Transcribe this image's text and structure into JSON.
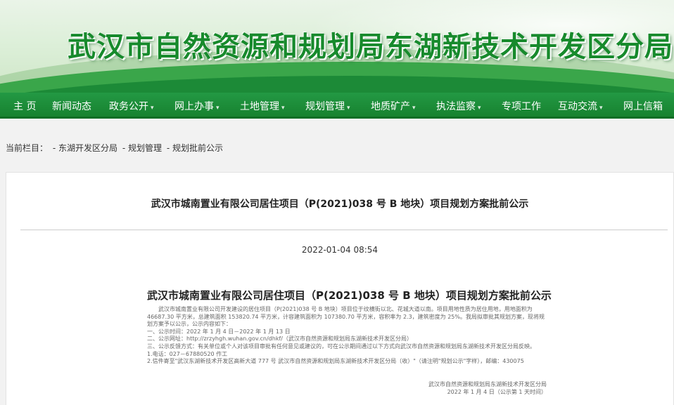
{
  "site_title": "武汉市自然资源和规划局东湖新技术开发区分局",
  "nav": [
    {
      "label": "主 页",
      "dropdown": false
    },
    {
      "label": "新闻动态",
      "dropdown": false
    },
    {
      "label": "政务公开",
      "dropdown": true
    },
    {
      "label": "网上办事",
      "dropdown": true
    },
    {
      "label": "土地管理",
      "dropdown": true
    },
    {
      "label": "规划管理",
      "dropdown": true
    },
    {
      "label": "地质矿产",
      "dropdown": true
    },
    {
      "label": "执法监察",
      "dropdown": true
    },
    {
      "label": "专项工作",
      "dropdown": false
    },
    {
      "label": "互动交流",
      "dropdown": true
    },
    {
      "label": "网上信箱",
      "dropdown": false
    }
  ],
  "breadcrumb": {
    "label": "当前栏目：",
    "items": [
      "- 东湖开发区分局",
      "- 规划管理",
      "- 规划批前公示"
    ]
  },
  "article": {
    "title": "武汉市城南置业有限公司居住项目（P(2021)038 号 B 地块）项目规划方案批前公示",
    "date": "2022-01-04 08:54",
    "body_title": "武汉市城南置业有限公司居住项目（P(2021)038 号 B 地块）项目规划方案批前公示",
    "paragraph": "武汉市城南置业有限公司开发建设的居住项目（P(2021)038 号 B 地块）项目位于纹横街以北、花城大道以南。项目用地性质为居住用地，用地面积为 46687.30 平方米，总建筑面积 153820.74 平方米，计容建筑面积为 107380.70 平方米，容积率为 2.3，建筑密度为 25%。我局拟审批其规划方案，现将规划方案予以公示，公示内容如下：",
    "lines": [
      "一、公示时间：2022 年 1 月 4 日－2022 年 1 月 13 日",
      "二、公示网址：http://zrzyhgh.wuhan.gov.cn/dhkf/（武汉市自然资源和规划局东湖新技术开发区分局）",
      "三、公示反馈方式：有关单位或个人对该项目审批有任何意见或建议的，可在公示期间通过以下方式向武汉市自然资源和规划局东湖新技术开发区分局反映。",
      "1.电话：027－67880520 作工",
      "2.信件寄至\"武汉东湖新技术开发区高新大道 777 号 武汉市自然资源和规划局东湖新技术开发区分局（收）\"（请注明\"规划公示\"字样），邮编：430075"
    ],
    "signature": "武汉市自然资源和规划局东湖新技术开发区分局",
    "sign_date": "2022 年 1 月 4 日（公示第 1 天时间）"
  }
}
